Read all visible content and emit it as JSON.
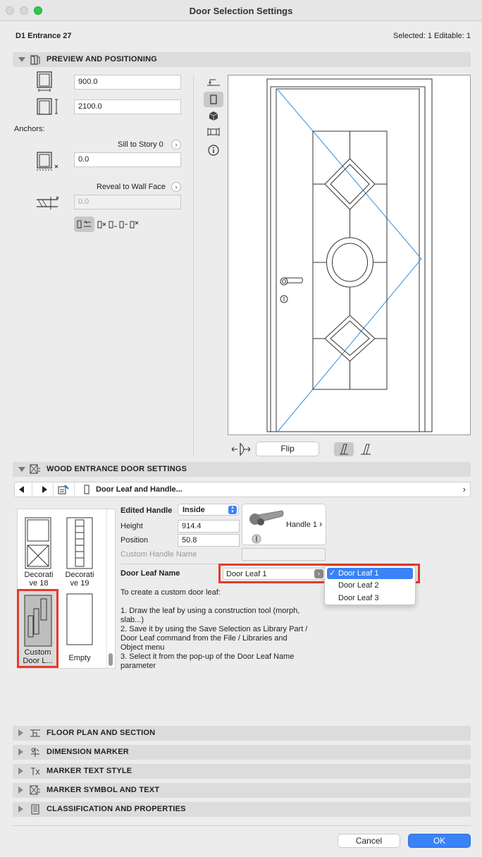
{
  "window": {
    "title": "Door Selection Settings"
  },
  "header": {
    "element_id": "D1 Entrance 27",
    "selection_info": "Selected: 1 Editable: 1"
  },
  "preview": {
    "section_label": "PREVIEW AND POSITIONING",
    "width_value": "900.0",
    "height_value": "2100.0",
    "anchors_label": "Anchors:",
    "sill_label": "Sill to Story 0",
    "sill_value": "0.0",
    "reveal_label": "Reveal to Wall Face",
    "reveal_value": "0.0",
    "flip_label": "Flip"
  },
  "wood": {
    "section_label": "WOOD ENTRANCE DOOR SETTINGS",
    "page_selector": "Door Leaf and Handle...",
    "thumbnails": [
      {
        "label": "Decorati\nve 18"
      },
      {
        "label": "Decorati\nve 19"
      },
      {
        "label": "Custom\nDoor L..."
      },
      {
        "label": "Empty"
      }
    ],
    "edited_handle_label": "Edited Handle",
    "edited_handle_value": "Inside",
    "height_label": "Height",
    "height_value": "914.4",
    "position_label": "Position",
    "position_value": "50.8",
    "custom_handle_label": "Custom Handle Name",
    "handle_picker_label": "Handle 1",
    "door_leaf_label": "Door Leaf Name",
    "door_leaf_value": "Door Leaf 1",
    "door_leaf_options": [
      "Door Leaf 1",
      "Door Leaf 2",
      "Door Leaf 3"
    ],
    "instructions_title": "To create a custom door leaf:",
    "instructions": [
      "1. Draw the leaf by using a construction tool (morph,",
      "slab...)",
      "2. Save it by using the Save Selection as Library Part /",
      "Door Leaf command from the File / Libraries and",
      "Object menu",
      "3. Select it from the pop-up of the Door Leaf Name",
      "parameter"
    ]
  },
  "collapsed_sections": [
    "FLOOR PLAN AND SECTION",
    "DIMENSION MARKER",
    "MARKER TEXT STYLE",
    "MARKER SYMBOL AND TEXT",
    "CLASSIFICATION AND PROPERTIES"
  ],
  "footer": {
    "cancel_label": "Cancel",
    "ok_label": "OK"
  },
  "colors": {
    "accent": "#3b82f6",
    "highlight_red": "#e43b2c",
    "section_bg": "#dcdcdc"
  }
}
